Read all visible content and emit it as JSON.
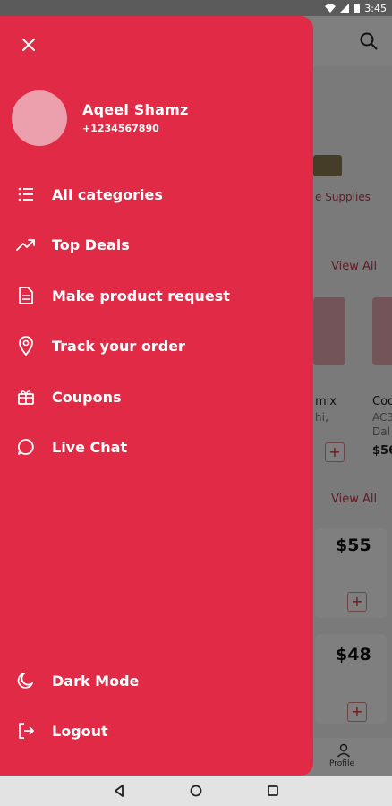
{
  "status_bar": {
    "time": "3:45"
  },
  "drawer": {
    "user": {
      "name": "Aqeel Shamz",
      "phone": "+1234567890"
    },
    "menu": [
      {
        "label": "All categories",
        "icon": "list-icon"
      },
      {
        "label": "Top Deals",
        "icon": "trending-up-icon"
      },
      {
        "label": "Make product request",
        "icon": "document-icon"
      },
      {
        "label": "Track your order",
        "icon": "location-pin-icon"
      },
      {
        "label": "Coupons",
        "icon": "gift-icon"
      },
      {
        "label": "Live Chat",
        "icon": "chat-bubble-icon"
      }
    ],
    "bottom_menu": [
      {
        "label": "Dark Mode",
        "icon": "moon-icon"
      },
      {
        "label": "Logout",
        "icon": "logout-icon"
      }
    ]
  },
  "background": {
    "category_label": "e Supplies",
    "view_all_1": "View All",
    "view_all_2": "View All",
    "product_1": {
      "name": "mix",
      "sub": "hi,"
    },
    "product_2": {
      "name": "Coc",
      "sub1": "AC3",
      "sub2": "Dal",
      "price": "$56"
    },
    "prices": [
      "$55",
      "$48"
    ],
    "plus": "+",
    "profile_label": "Profile"
  },
  "colors": {
    "drawer_bg": "#e12a45",
    "accent": "#c03a4a"
  }
}
